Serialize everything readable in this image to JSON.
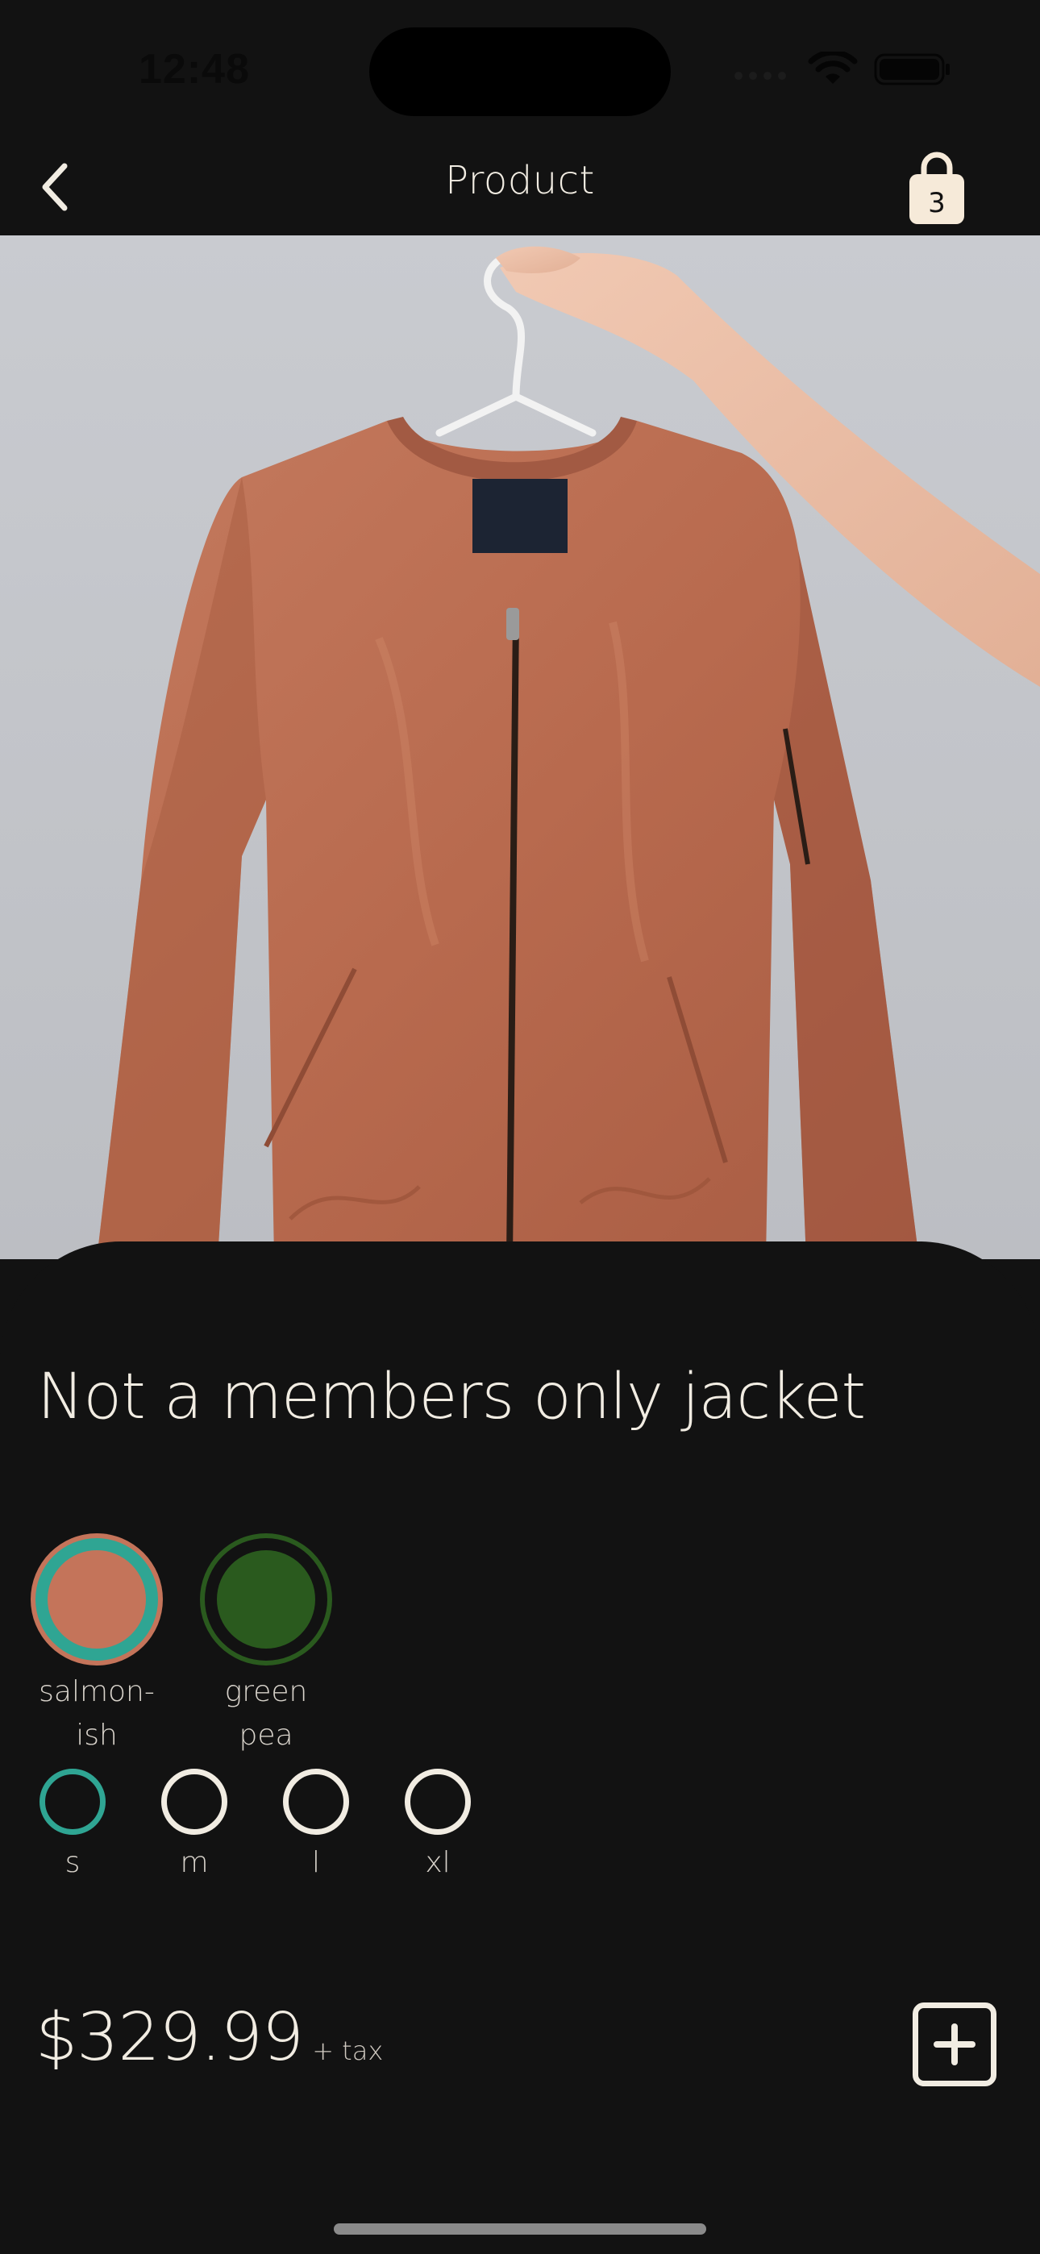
{
  "status_bar": {
    "time": "12:48"
  },
  "nav": {
    "title": "Product",
    "cart_count": "3"
  },
  "product": {
    "title": "Not a members only jacket",
    "colors": [
      {
        "label_line1": "salmon-",
        "label_line2": "ish",
        "swatch": "#c4745a",
        "selected": true
      },
      {
        "label_line1": "green",
        "label_line2": "pea",
        "swatch": "#2a5a1e",
        "selected": false
      }
    ],
    "sizes": [
      {
        "label": "s",
        "selected": true
      },
      {
        "label": "m",
        "selected": false
      },
      {
        "label": "l",
        "selected": false
      },
      {
        "label": "xl",
        "selected": false
      }
    ],
    "price": "$329.99",
    "tax_note": "+ tax"
  },
  "colors": {
    "background": "#121212",
    "accent_teal": "#2fa593",
    "text": "#f1ece2",
    "cart_badge": "#f6ead9"
  }
}
